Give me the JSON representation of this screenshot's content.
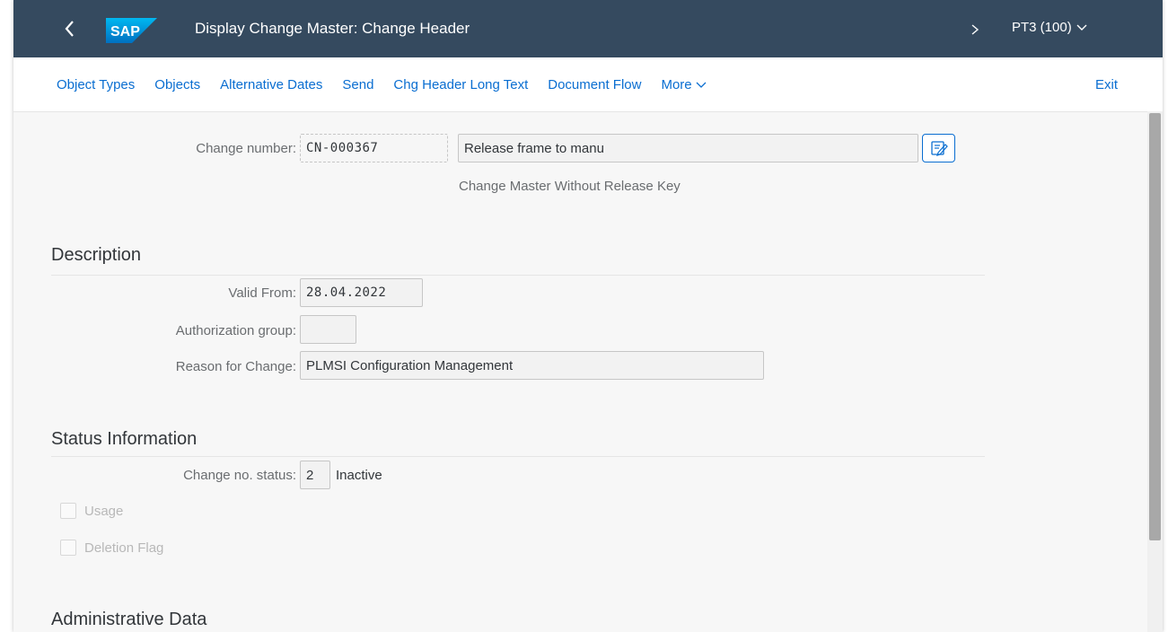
{
  "shell": {
    "title": "Display Change Master: Change Header",
    "system": "PT3 (100)"
  },
  "toolbar": {
    "object_types": "Object Types",
    "objects": "Objects",
    "alternative_dates": "Alternative Dates",
    "send": "Send",
    "chg_header_long_text": "Chg Header Long Text",
    "document_flow": "Document Flow",
    "more": "More",
    "exit": "Exit"
  },
  "header": {
    "change_number_label": "Change number:",
    "change_number_value": "CN-000367",
    "description_value": "Release frame to manu",
    "note": "Change Master Without Release Key"
  },
  "description_section": {
    "title": "Description",
    "valid_from_label": "Valid From:",
    "valid_from_value": "28.04.2022",
    "authorization_group_label": "Authorization group:",
    "authorization_group_value": "",
    "reason_label": "Reason for Change:",
    "reason_value": "PLMSI Configuration Management"
  },
  "status_section": {
    "title": "Status Information",
    "status_label": "Change no. status:",
    "status_value": "2",
    "status_text": "Inactive",
    "usage_label": "Usage",
    "deletion_flag_label": "Deletion Flag"
  },
  "admin_section": {
    "title": "Administrative Data"
  },
  "colors": {
    "shell_bg": "#354a5f",
    "link": "#0a6ed1",
    "page_bg": "#f7f7f7"
  },
  "icons": {
    "back": "chevron-left-icon",
    "forward": "chevron-right-icon",
    "dropdown": "chevron-down-icon",
    "edit_text": "edit-text-icon"
  }
}
